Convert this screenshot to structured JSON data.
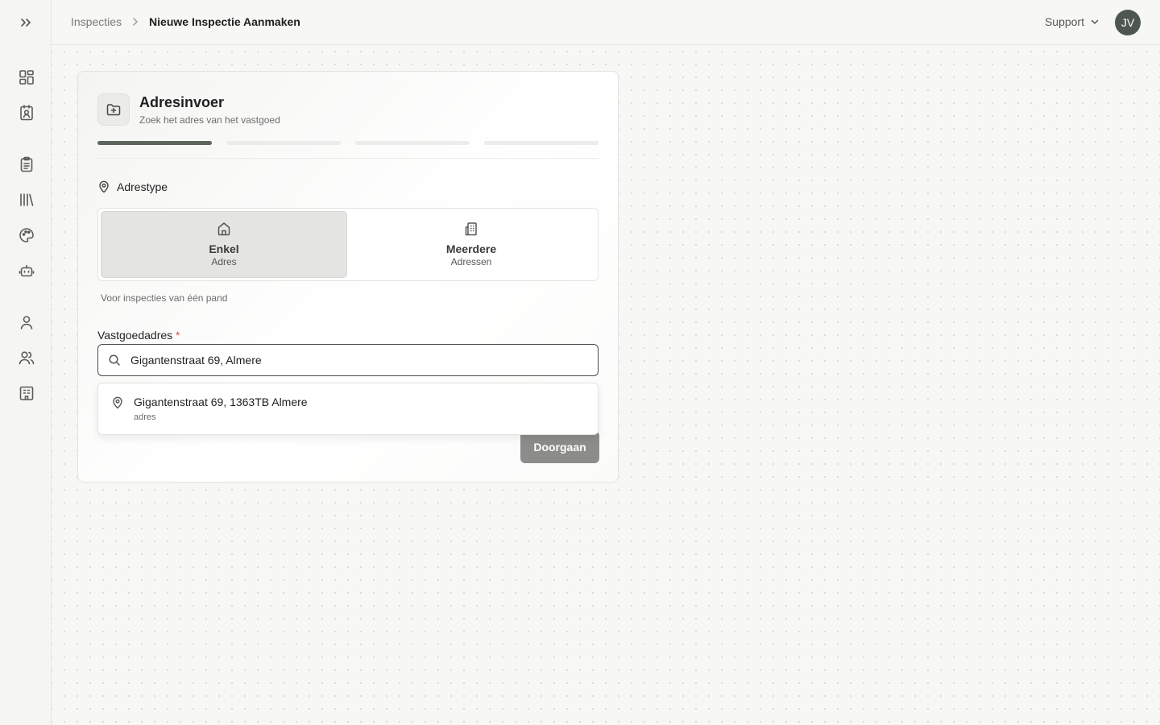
{
  "breadcrumb": {
    "parent": "Inspecties",
    "current": "Nieuwe Inspectie Aanmaken"
  },
  "header": {
    "support_label": "Support",
    "avatar_initials": "JV"
  },
  "card": {
    "title": "Adresinvoer",
    "subtitle": "Zoek het adres van het vastgoed",
    "step_count": 4,
    "active_step": 1
  },
  "address_type": {
    "label": "Adrestype",
    "options": [
      {
        "title": "Enkel",
        "subtitle": "Adres",
        "selected": true
      },
      {
        "title": "Meerdere",
        "subtitle": "Adressen",
        "selected": false
      }
    ],
    "hint": "Voor inspecties van één pand"
  },
  "address_field": {
    "label": "Vastgoedadres",
    "required_marker": "*",
    "value": "Gigantenstraat 69, Almere"
  },
  "suggestions": [
    {
      "title": "Gigantenstraat 69, 1363TB Almere",
      "type": "adres"
    }
  ],
  "continue_label": "Doorgaan",
  "colors": {
    "accent": "#5c665d",
    "avatar_bg": "#4e574f",
    "button_disabled": "#8c8c8a",
    "required": "#d9534f"
  }
}
